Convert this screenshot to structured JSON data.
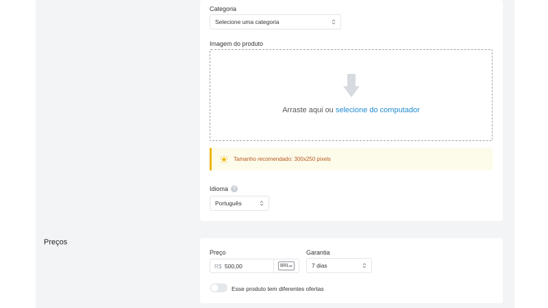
{
  "form": {
    "category": {
      "label": "Categoria",
      "value": "Selecione uma categoria"
    },
    "image": {
      "label": "Imagem do produto",
      "drop_text": "Arraste aqui ou ",
      "drop_link": "selecione do computador",
      "icon": "download-arrow-icon"
    },
    "alert": {
      "message": "Tamanho recomendado: 300x250 pixels",
      "icon": "sun-icon",
      "color": "#f0b400"
    },
    "language": {
      "label": "Idioma",
      "help_icon": "?",
      "value": "Português"
    }
  },
  "pricing": {
    "section_title": "Preços",
    "price": {
      "label": "Preço",
      "prefix": "R$",
      "value": "500,00",
      "currency": "BRL"
    },
    "warranty": {
      "label": "Garantia",
      "value": "7 dias"
    },
    "offers_toggle": {
      "label": "Esse produto tem diferentes ofertas",
      "enabled": false
    }
  },
  "colors": {
    "link": "#1f8ad0",
    "alert_text": "#b5571f",
    "alert_bg": "#fdfbea"
  }
}
